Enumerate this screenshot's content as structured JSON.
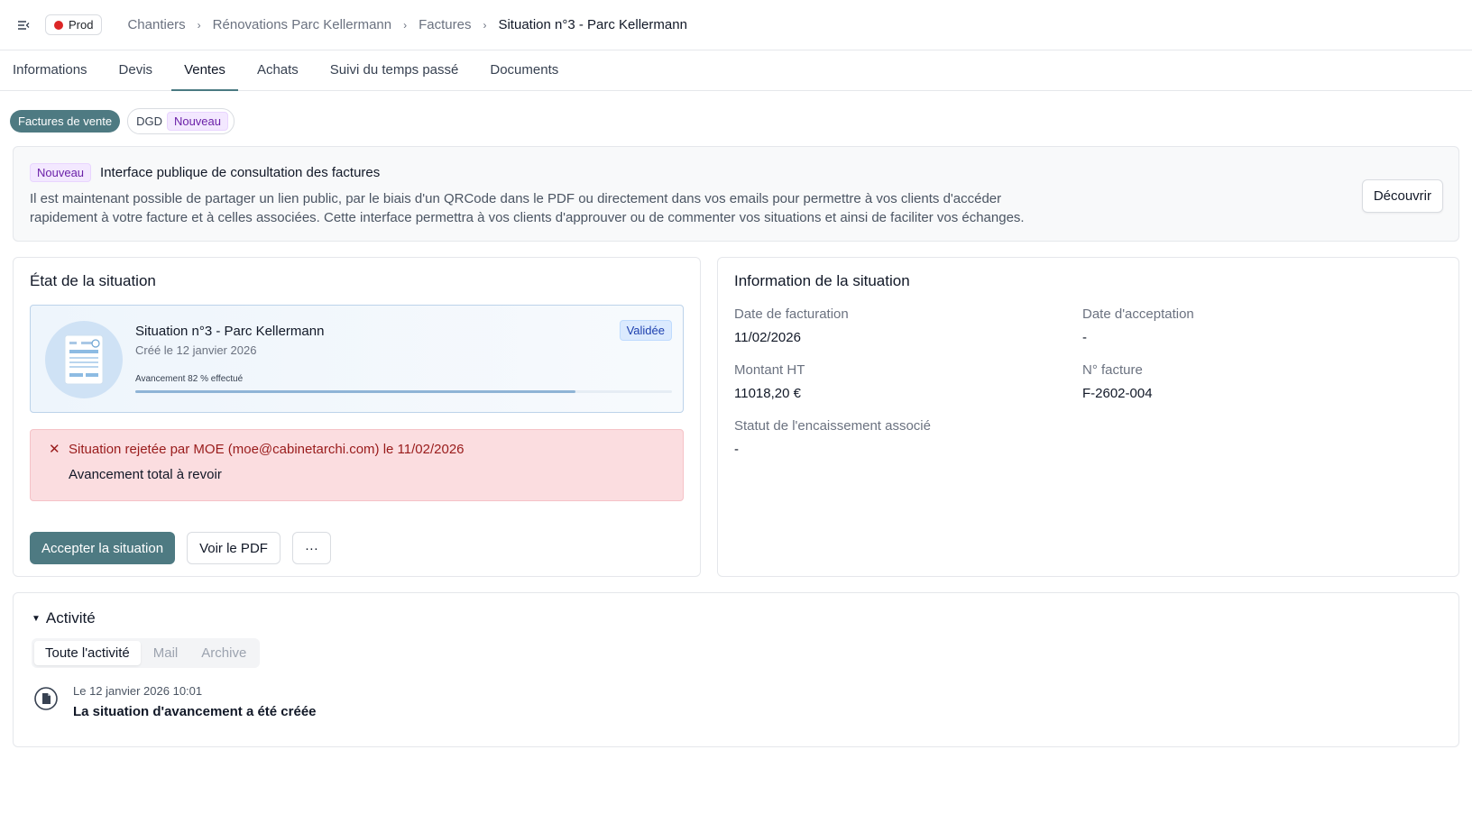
{
  "env_badge": "Prod",
  "breadcrumb": [
    "Chantiers",
    "Rénovations Parc Kellermann",
    "Factures",
    "Situation n°3 - Parc Kellermann"
  ],
  "tabs": [
    "Informations",
    "Devis",
    "Ventes",
    "Achats",
    "Suivi du temps passé",
    "Documents"
  ],
  "active_tab": "Ventes",
  "pills": {
    "sales_invoices": "Factures de vente",
    "dgd": "DGD",
    "dgd_tag": "Nouveau"
  },
  "banner": {
    "tag": "Nouveau",
    "title": "Interface publique de consultation des factures",
    "text": "Il est maintenant possible de partager un lien public, par le biais d'un QRCode dans le PDF ou directement dans vos emails pour permettre à vos clients d'accéder rapidement à votre facture et à celles associées. Cette interface permettra à vos clients d'approuver ou de commenter vos situations et ainsi de faciliter vos échanges.",
    "button": "Découvrir"
  },
  "state_card": {
    "title": "État de la situation",
    "situation_title": "Situation n°3 - Parc Kellermann",
    "created": "Créé le 12 janvier 2026",
    "progress_label": "Avancement 82 % effectué",
    "progress_value": 82,
    "status": "Validée",
    "alert_title": "Situation rejetée par MOE (moe@cabinetarchi.com) le 11/02/2026",
    "alert_detail": "Avancement total à revoir",
    "btn_accept": "Accepter la situation",
    "btn_pdf": "Voir le PDF",
    "btn_more": "···"
  },
  "info_card": {
    "title": "Information de la situation",
    "billing_date_label": "Date de facturation",
    "billing_date": "11/02/2026",
    "acceptance_date_label": "Date d'acceptation",
    "acceptance_date": "-",
    "amount_label": "Montant HT",
    "amount": "11018,20 €",
    "invoice_no_label": "N° facture",
    "invoice_no": "F-2602-004",
    "collection_status_label": "Statut de l'encaissement associé",
    "collection_status": "-"
  },
  "activity": {
    "title": "Activité",
    "filters": [
      "Toute l'activité",
      "Mail",
      "Archive"
    ],
    "entry_date": "Le 12 janvier 2026 10:01",
    "entry_text": "La situation d'avancement a été créée"
  },
  "colors": {
    "accent": "#4e7a82",
    "env_dot": "#dc2626",
    "alert_bg": "#fbdde0",
    "alert_text": "#991b1b",
    "status_bg": "#dbeafe"
  },
  "icons": [
    "menu-collapse-icon",
    "chevron-right-icon",
    "document-illustration-icon",
    "close-icon",
    "caret-down-icon",
    "document-icon"
  ]
}
